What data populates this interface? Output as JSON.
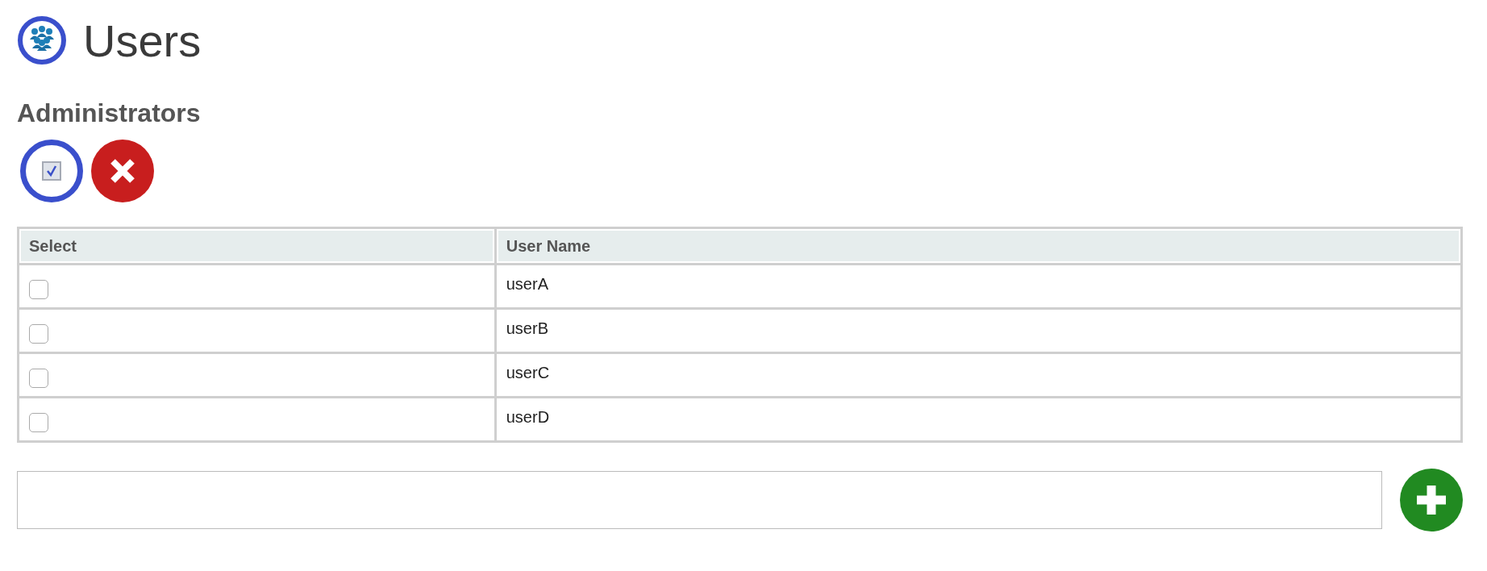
{
  "page": {
    "title": "Users"
  },
  "section": {
    "heading": "Administrators"
  },
  "toolbar": [
    {
      "kind": "select_all"
    },
    {
      "kind": "delete"
    }
  ],
  "table": {
    "columns": [
      "Select",
      "User Name"
    ],
    "rows": [
      {
        "name": "userA",
        "checked": false
      },
      {
        "name": "userB",
        "checked": false
      },
      {
        "name": "userC",
        "checked": false
      },
      {
        "name": "userD",
        "checked": false
      }
    ]
  },
  "add_user": {
    "kind": "add"
  }
}
